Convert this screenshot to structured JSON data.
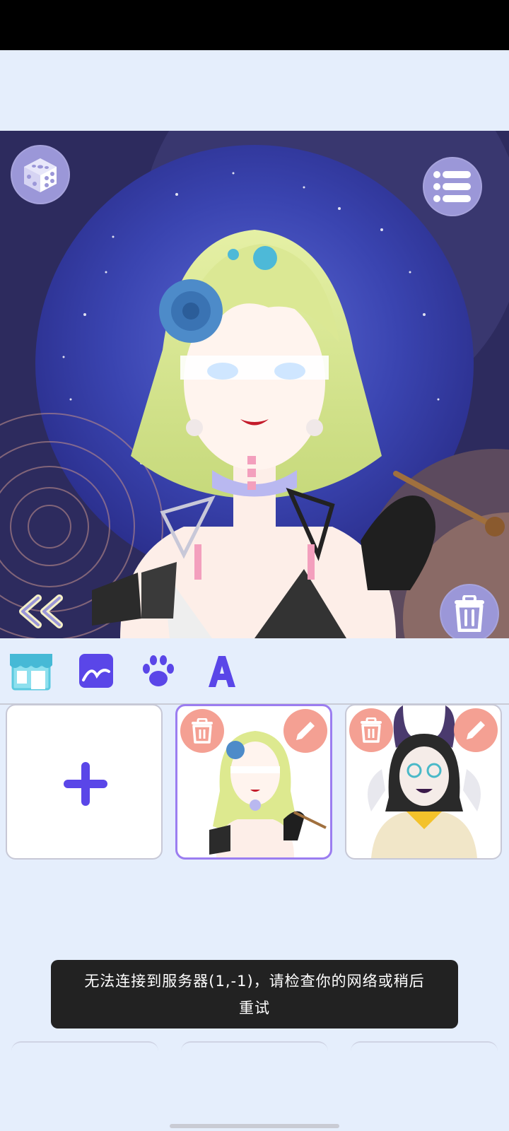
{
  "status_bar": {},
  "stage": {
    "controls": {
      "randomize_icon": "dice-icon",
      "menu_icon": "list-icon",
      "delete_icon": "trash-icon",
      "collapse_icon": "double-chevron-left-icon"
    },
    "colors": {
      "background": "#2d2b5e",
      "moon": "#3f4ab6",
      "button": "#9b97d8"
    }
  },
  "toolbar": {
    "tabs": [
      {
        "name": "shop",
        "icon": "store-icon"
      },
      {
        "name": "background",
        "icon": "landscape-icon"
      },
      {
        "name": "pets",
        "icon": "paw-icon"
      },
      {
        "name": "text",
        "icon": "letter-a-icon"
      }
    ]
  },
  "slots": {
    "new_icon": "plus-icon",
    "items": [
      {
        "selected": true,
        "character": "blonde-girl-blue-rose"
      },
      {
        "selected": false,
        "character": "horned-girl-glasses"
      }
    ]
  },
  "toast": {
    "message": "无法连接到服务器(1,-1)，请检查你的网络或稍后重试"
  },
  "colors": {
    "page_bg": "#e5eefc",
    "accent": "#5a46e8",
    "slot_action": "#f4a093",
    "selected_border": "#9b7df0"
  }
}
